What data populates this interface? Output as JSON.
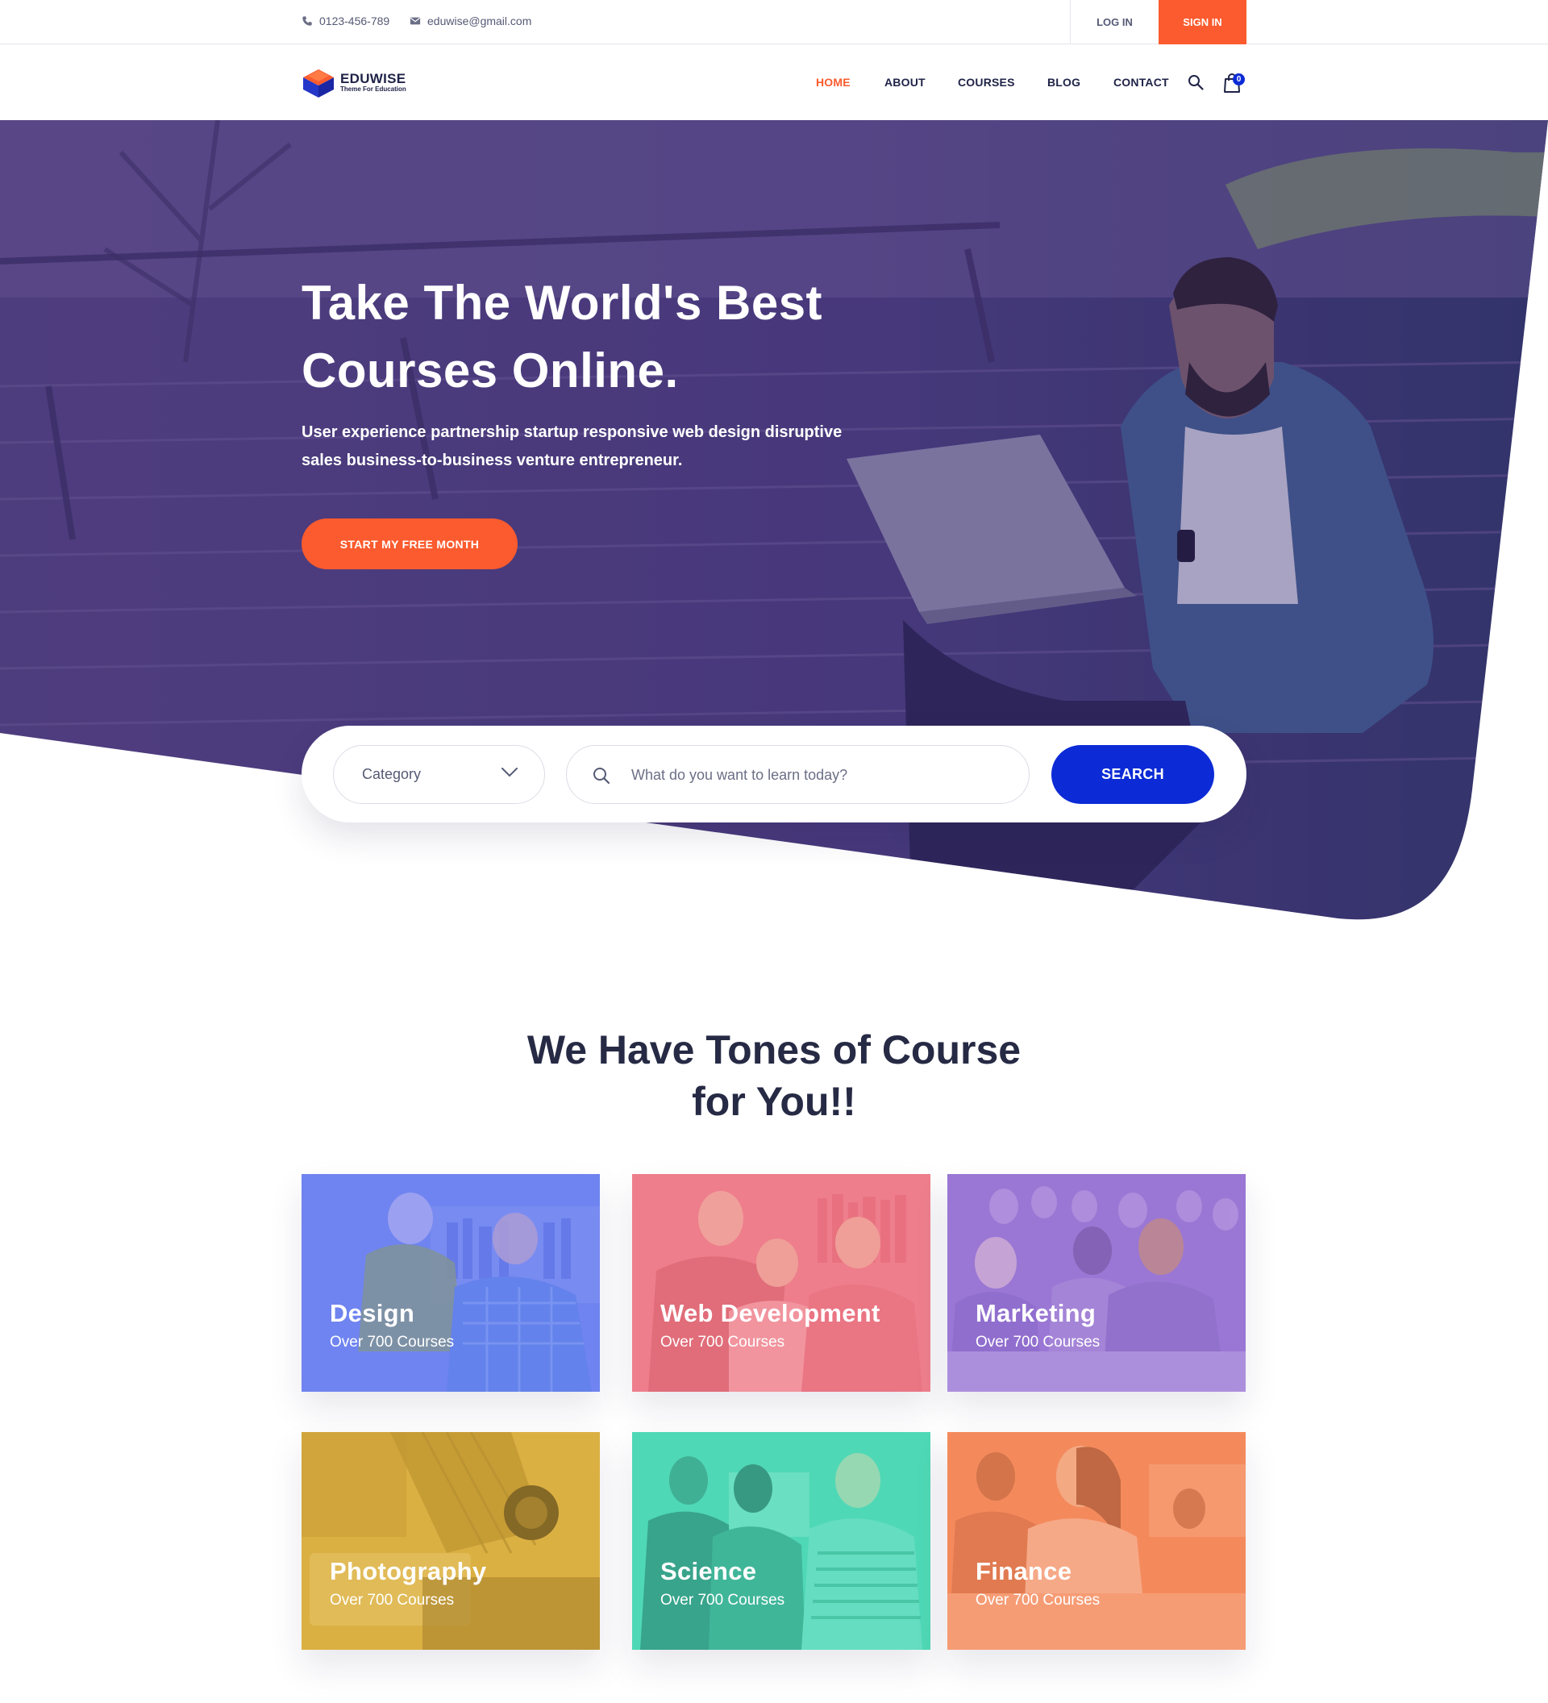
{
  "topbar": {
    "phone": "0123-456-789",
    "email": "eduwise@gmail.com",
    "login": "LOG IN",
    "signin": "SIGN IN"
  },
  "brand": {
    "name": "EDUWISE",
    "tagline": "Theme For Education"
  },
  "nav": {
    "items": [
      {
        "label": "HOME",
        "active": true
      },
      {
        "label": "ABOUT",
        "active": false
      },
      {
        "label": "COURSES",
        "active": false
      },
      {
        "label": "BLOG",
        "active": false
      },
      {
        "label": "CONTACT",
        "active": false
      }
    ],
    "cart_count": "0"
  },
  "hero": {
    "title_line1": "Take The World's Best",
    "title_line2": "Courses Online.",
    "subtitle_line1": "User experience partnership startup responsive web design disruptive",
    "subtitle_line2": "sales business-to-business venture entrepreneur.",
    "cta": "START MY FREE MONTH"
  },
  "search": {
    "category_placeholder": "Category",
    "input_placeholder": "What do you want to learn today?",
    "button": "SEARCH"
  },
  "section": {
    "title_line1": "We Have Tones of Course",
    "title_line2": "for You!!"
  },
  "categories": [
    {
      "title": "Design",
      "count": "Over 700 Courses",
      "color": "#6f84f0"
    },
    {
      "title": "Web Development",
      "count": "Over 700 Courses",
      "color": "#ef7f8c"
    },
    {
      "title": "Marketing",
      "count": "Over 700 Courses",
      "color": "#9a78d4"
    },
    {
      "title": "Photography",
      "count": "Over 700 Courses",
      "color": "#dcb042"
    },
    {
      "title": "Science",
      "count": "Over 700 Courses",
      "color": "#4fd8b5"
    },
    {
      "title": "Finance",
      "count": "Over 700 Courses",
      "color": "#f48a5c"
    }
  ],
  "colors": {
    "accent": "#fb5b2e",
    "primary": "#0c2bd6",
    "hero_overlay": "#4b3b86",
    "heading": "#262a44"
  }
}
